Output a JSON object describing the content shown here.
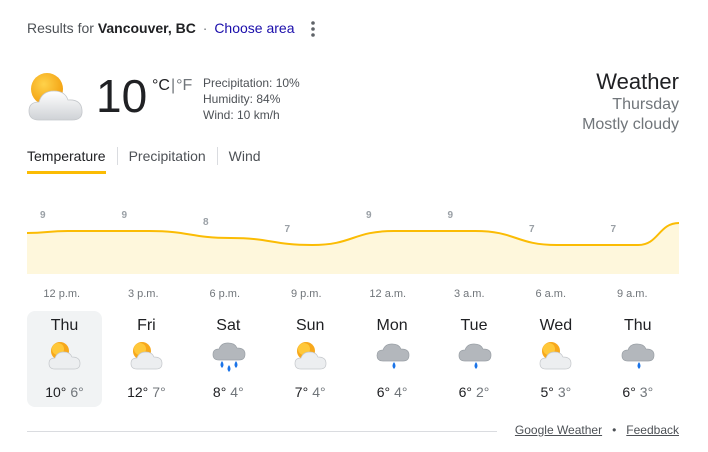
{
  "header": {
    "results_prefix": "Results for",
    "location": "Vancouver, BC",
    "separator": "·",
    "choose_area": "Choose area",
    "more_icon": "more-vert-icon"
  },
  "current": {
    "icon": "mostly-cloudy-icon",
    "temperature": "10",
    "unit_c": "°C",
    "unit_divider": "|",
    "unit_f": "°F",
    "precipitation": "Precipitation: 10%",
    "humidity": "Humidity: 84%",
    "wind": "Wind: 10 km/h"
  },
  "summary": {
    "title": "Weather",
    "day": "Thursday",
    "condition": "Mostly cloudy"
  },
  "tabs": [
    {
      "label": "Temperature",
      "active": true
    },
    {
      "label": "Precipitation",
      "active": false
    },
    {
      "label": "Wind",
      "active": false
    }
  ],
  "chart_data": {
    "type": "area",
    "x": [
      "12 p.m.",
      "3 p.m.",
      "6 p.m.",
      "9 p.m.",
      "12 a.m.",
      "3 a.m.",
      "6 a.m.",
      "9 a.m."
    ],
    "values": [
      9,
      9,
      8,
      7,
      9,
      9,
      7,
      7
    ],
    "value_labels": [
      "9",
      "9",
      "8",
      "7",
      "9",
      "9",
      "7",
      "7"
    ],
    "title": "",
    "xlabel": "",
    "ylabel": "",
    "grid": false,
    "colors": {
      "line": "#fbbc04",
      "fill": "#fef7dc",
      "label": "#9aa0a6"
    }
  },
  "days": [
    {
      "name": "Thu",
      "icon": "partly-cloudy-icon",
      "high": "10°",
      "low": "6°",
      "selected": true
    },
    {
      "name": "Fri",
      "icon": "partly-cloudy-icon",
      "high": "12°",
      "low": "7°",
      "selected": false
    },
    {
      "name": "Sat",
      "icon": "rain-showers-icon",
      "high": "8°",
      "low": "4°",
      "selected": false
    },
    {
      "name": "Sun",
      "icon": "partly-cloudy-icon",
      "high": "7°",
      "low": "4°",
      "selected": false
    },
    {
      "name": "Mon",
      "icon": "light-rain-icon",
      "high": "6°",
      "low": "4°",
      "selected": false
    },
    {
      "name": "Tue",
      "icon": "light-rain-icon",
      "high": "6°",
      "low": "2°",
      "selected": false
    },
    {
      "name": "Wed",
      "icon": "partly-cloudy-icon",
      "high": "5°",
      "low": "3°",
      "selected": false
    },
    {
      "name": "Thu",
      "icon": "light-rain-icon",
      "high": "6°",
      "low": "3°",
      "selected": false
    }
  ],
  "footer": {
    "source": "Google Weather",
    "dot": "•",
    "feedback": "Feedback"
  }
}
